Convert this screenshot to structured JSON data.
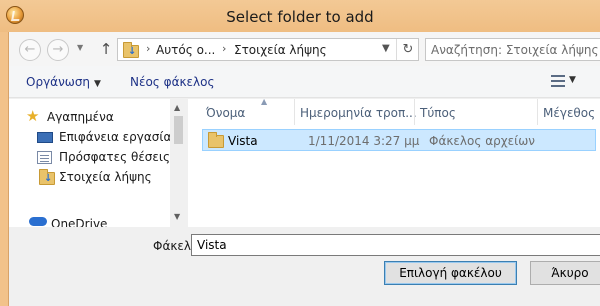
{
  "window": {
    "title": "Select folder to add"
  },
  "nav": {
    "breadcrumbs": [
      "Αυτός ο...",
      "Στοιχεία λήψης"
    ],
    "search_placeholder": "Αναζήτηση: Στοιχεία λήψης"
  },
  "toolbar": {
    "organize": "Οργάνωση",
    "new_folder": "Νέος φάκελος"
  },
  "sidebar": {
    "items": [
      {
        "label": "Αγαπημένα",
        "icon": "star-icon"
      },
      {
        "label": "Επιφάνεια εργασίας",
        "icon": "desktop-icon"
      },
      {
        "label": "Πρόσφατες θέσεις",
        "icon": "recent-places-icon"
      },
      {
        "label": "Στοιχεία λήψης",
        "icon": "downloads-folder-icon"
      },
      {
        "label": "OneDrive",
        "icon": "onedrive-icon"
      }
    ]
  },
  "columns": [
    "Όνομα",
    "Ημερομηνία τροπ...",
    "Τύπος",
    "Μέγεθος"
  ],
  "rows": [
    {
      "name": "Vista",
      "date": "1/11/2014 3:27 μμ",
      "type": "Φάκελος αρχείων",
      "size": ""
    }
  ],
  "footer": {
    "folder_label": "Φάκελος:",
    "folder_value": "Vista",
    "select_button": "Επιλογή φακέλου",
    "cancel_button": "Άκυρο"
  },
  "colors": {
    "titlebar": "#f0c28a",
    "selection": "#cce8ff",
    "link_text": "#1e3287"
  }
}
